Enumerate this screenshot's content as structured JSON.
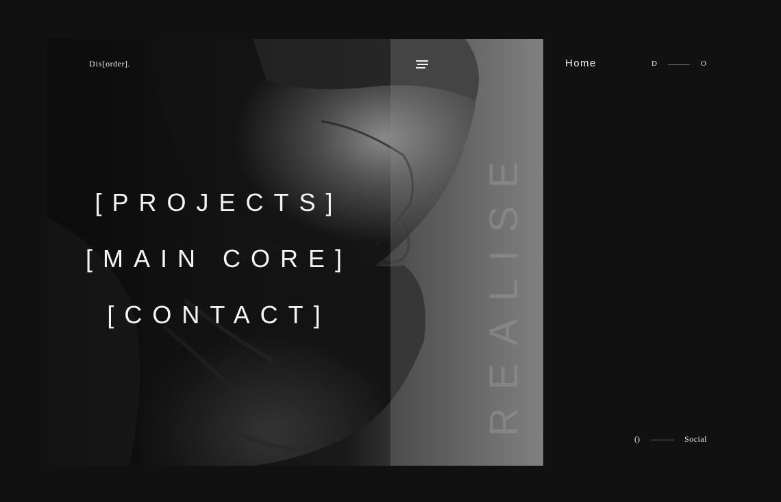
{
  "brand": {
    "logo_prefix": "Dis",
    "logo_bracket": "[order]",
    "logo_suffix": "."
  },
  "menu": {
    "icon": "hamburger-menu-icon"
  },
  "nav": {
    "items": [
      "[PROJECTS]",
      "[MAIN CORE]",
      "[CONTACT]"
    ]
  },
  "hero": {
    "vertical_word": "REALISE",
    "photo": "bearded-man-profile-photo"
  },
  "header_right": {
    "home_label": "Home",
    "indicator_start": "D",
    "indicator_end": "O"
  },
  "footer_right": {
    "indicator_start": "()",
    "social_label": "Social"
  },
  "colors": {
    "background": "#111112",
    "text": "#f5f5f5",
    "band": "#5a5a5a"
  }
}
